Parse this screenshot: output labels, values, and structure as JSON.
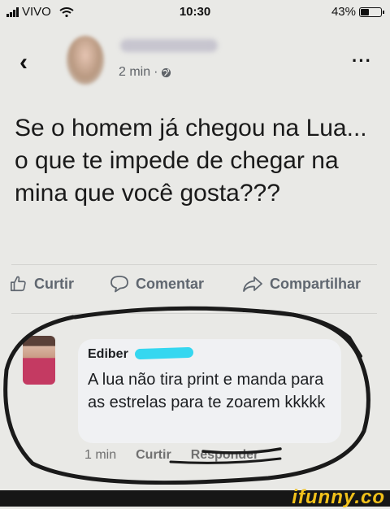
{
  "status": {
    "carrier": "VIVO",
    "time": "10:30",
    "battery_pct": "43%",
    "battery_level": 0.43
  },
  "post": {
    "meta_time": "2 min",
    "meta_sep": "·",
    "text": "Se o homem já chegou na Lua... o que te impede de chegar na mina que você gosta???"
  },
  "actions": {
    "like": "Curtir",
    "comment": "Comentar",
    "share": "Compartilhar"
  },
  "comment": {
    "author": "Ediber",
    "text": "A lua não tira print e manda para as estrelas para te zoarem kkkkk",
    "time": "1 min",
    "like": "Curtir",
    "reply": "Responder"
  },
  "watermark": {
    "brand": "ifunny.co"
  },
  "colors": {
    "brand": "#f2c11a",
    "redaction_mark": "#35d7f0"
  }
}
